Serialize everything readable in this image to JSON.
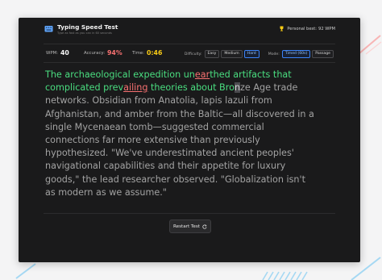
{
  "app": {
    "title": "Typing Speed Test",
    "subtitle": "Type as fast as you can in 60 seconds",
    "personal_best_label": "Personal best:",
    "personal_best_value": "92 WPM"
  },
  "stats": {
    "wpm_label": "WPM:",
    "wpm_value": "40",
    "accuracy_label": "Accuracy:",
    "accuracy_value": "94%",
    "time_label": "Time:",
    "time_value": "0:46"
  },
  "difficulty": {
    "label": "Difficulty:",
    "options": [
      "Easy",
      "Medium",
      "Hard"
    ],
    "selected": "Hard"
  },
  "mode": {
    "label": "Mode:",
    "options": [
      "Timed (60s)",
      "Passage"
    ],
    "selected": "Timed (60s)"
  },
  "passage": {
    "segments": [
      {
        "text": "The archaeological expedition un",
        "state": "typed"
      },
      {
        "text": "ear",
        "state": "error"
      },
      {
        "text": "thed artifacts that\ncomplicated prev",
        "state": "typed"
      },
      {
        "text": "ailing",
        "state": "error"
      },
      {
        "text": " theories about Bro",
        "state": "typed"
      },
      {
        "text": "n",
        "state": "cursor"
      },
      {
        "text": "ze Age trade\nnetworks. Obsidian from Anatolia, lapis lazuli from\nAfghanistan, and amber from the Baltic—all discovered in a\nsingle Mycenaean tomb—suggested commercial\nconnections far more extensive than previously\nhypothesized. \"We've underestimated ancient peoples'\nnavigational capabilities and their appetite for luxury\ngoods,\" the lead researcher observed. \"Globalization isn't\nas modern as we assume.\"",
        "state": "pending"
      }
    ]
  },
  "restart_label": "Restart Test",
  "icons": {
    "app": "keyboard-icon",
    "personal_best": "trophy-icon",
    "restart": "restart-icon"
  },
  "colors": {
    "typed": "#4ade80",
    "error": "#f87171",
    "pending": "#a3a3a3",
    "accuracy": "#f87171",
    "time": "#facc15",
    "selected_chip": "#3b82f6"
  }
}
